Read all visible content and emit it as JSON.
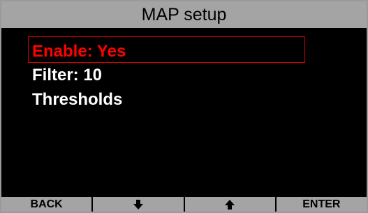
{
  "header": {
    "title": "MAP setup"
  },
  "menu": {
    "items": [
      {
        "label": "Enable: Yes",
        "selected": true
      },
      {
        "label": "Filter: 10",
        "selected": false
      },
      {
        "label": "Thresholds",
        "selected": false
      }
    ]
  },
  "softkeys": {
    "back_label": "BACK",
    "down_icon": "down-arrow-icon",
    "up_icon": "up-arrow-icon",
    "enter_label": "ENTER"
  },
  "colors": {
    "title_bar": "#a4a4a4",
    "background": "#000000",
    "selected_text": "#ff0000",
    "normal_text": "#ffffff"
  }
}
